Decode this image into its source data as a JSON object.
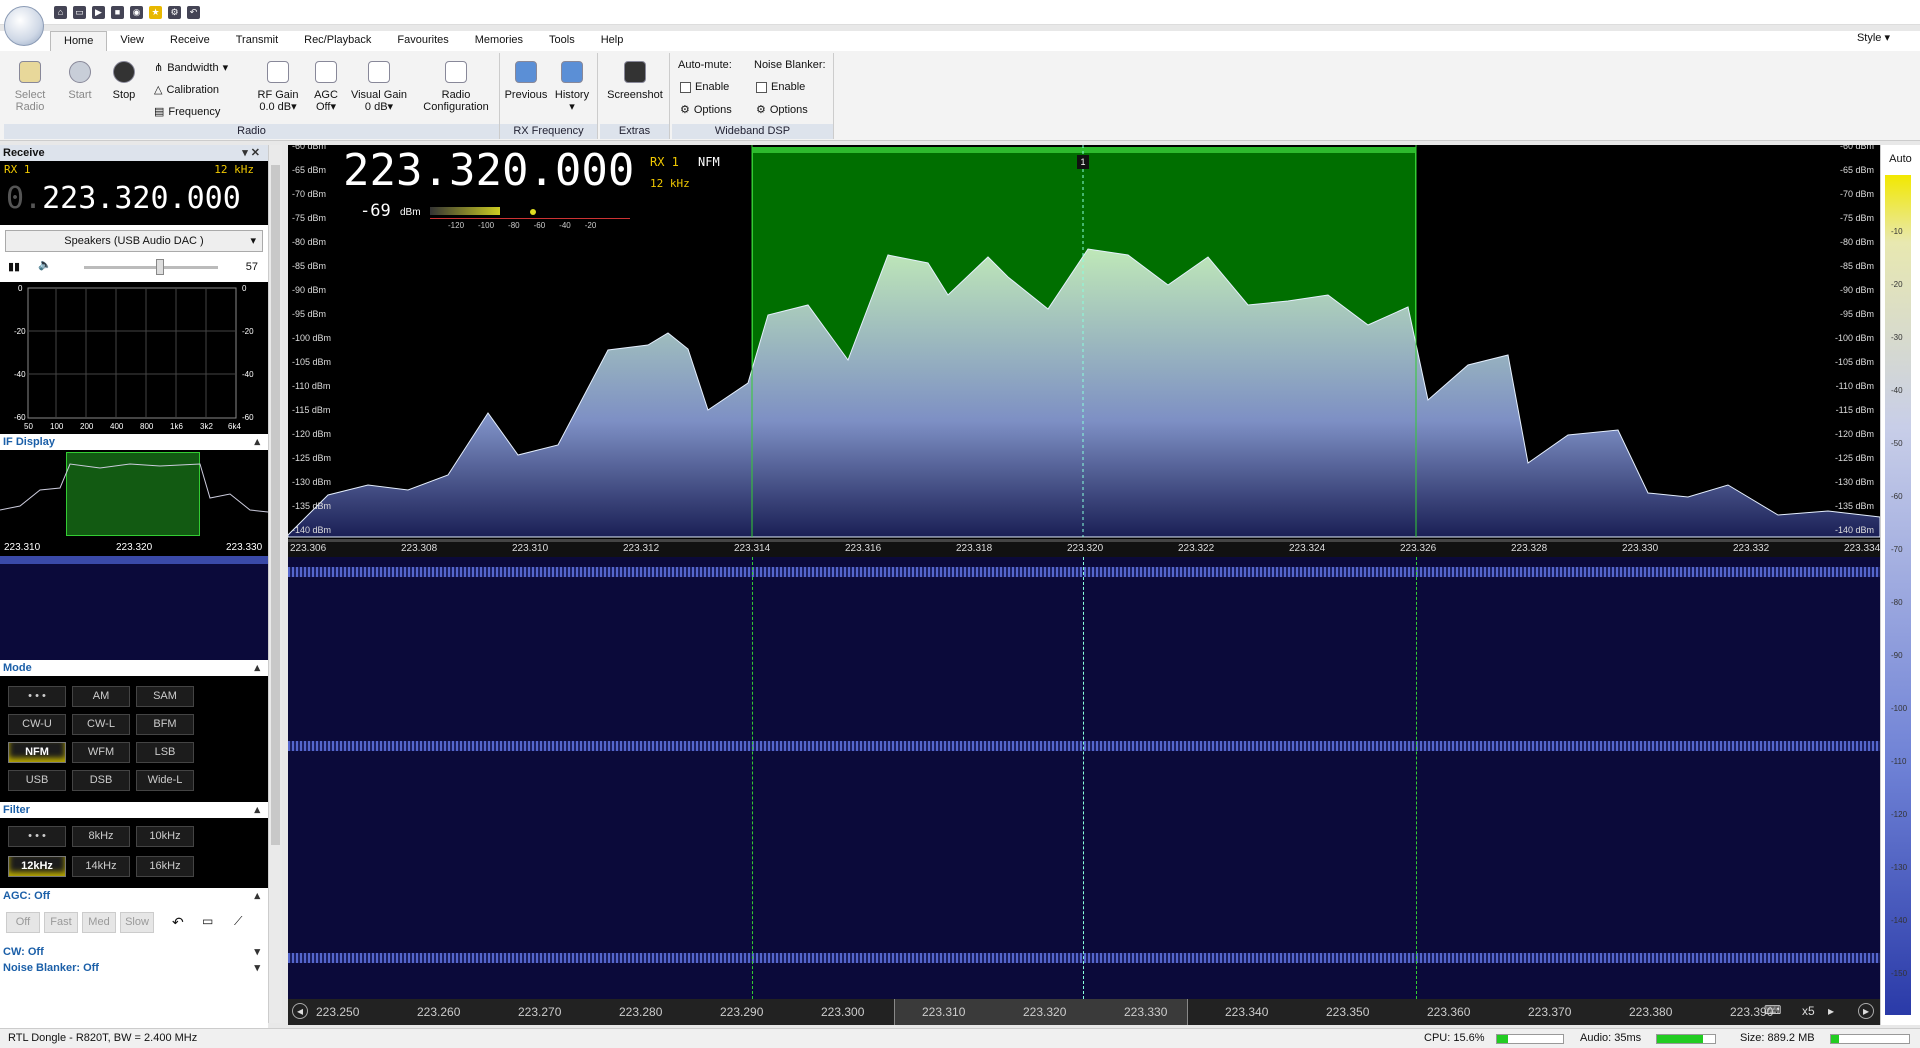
{
  "ribbon": {
    "tabs": [
      "Home",
      "View",
      "Receive",
      "Transmit",
      "Rec/Playback",
      "Favourites",
      "Memories",
      "Tools",
      "Help"
    ],
    "style_label": "Style",
    "select_radio": "Select\nRadio",
    "start": "Start",
    "stop": "Stop",
    "bandwidth": "Bandwidth",
    "calibration": "Calibration",
    "frequency": "Frequency",
    "rf_gain": "RF Gain",
    "rf_gain_val": "0.0 dB",
    "agc": "AGC",
    "agc_val": "Off",
    "visual_gain": "Visual Gain",
    "visual_gain_val": "0 dB",
    "radio_config": "Radio",
    "radio_config2": "Configuration",
    "previous": "Previous",
    "history": "History",
    "screenshot": "Screenshot",
    "auto_mute": "Auto-mute:",
    "noise_blanker": "Noise Blanker:",
    "enable": "Enable",
    "options": "Options",
    "groups": {
      "radio": "Radio",
      "rx_frequency": "RX Frequency",
      "extras": "Extras",
      "wideband_dsp": "Wideband DSP"
    }
  },
  "receive": {
    "title": "Receive",
    "rx": "RX 1",
    "bw": "12 kHz",
    "freq_lead": "0.",
    "freq": "223.320.000",
    "audio_device": "Speakers (USB Audio DAC  )",
    "volume": "57"
  },
  "audio_chart": {
    "y_labels": [
      "0",
      "-20",
      "-40",
      "-60"
    ],
    "x_labels": [
      "50",
      "100",
      "200",
      "400",
      "800",
      "1k6",
      "3k2",
      "6k4"
    ]
  },
  "if_display": {
    "title": "IF Display",
    "labels": [
      "223.310",
      "223.320",
      "223.330"
    ]
  },
  "mode": {
    "title": "Mode",
    "buttons": [
      "• • •",
      "AM",
      "SAM",
      "CW-U",
      "CW-L",
      "BFM",
      "NFM",
      "WFM",
      "LSB",
      "USB",
      "DSB",
      "Wide-L"
    ],
    "selected": "NFM"
  },
  "filter": {
    "title": "Filter",
    "buttons": [
      "• • •",
      "8kHz",
      "10kHz",
      "12kHz",
      "14kHz",
      "16kHz"
    ],
    "selected": "12kHz"
  },
  "agc": {
    "title": "AGC: Off",
    "buttons": [
      "Off",
      "Fast",
      "Med",
      "Slow"
    ]
  },
  "cw": {
    "title": "CW: Off"
  },
  "nb": {
    "title": "Noise Blanker: Off"
  },
  "spectrum": {
    "freq": "223.320.000",
    "rx": "RX 1",
    "mode": "NFM",
    "bw": "12 kHz",
    "signal": "-69",
    "signal_unit": "dBm",
    "meter_scale": [
      "-120",
      "-100",
      "-80",
      "-60",
      "-40",
      "-20"
    ],
    "marker": "1",
    "y_labels": [
      "-60 dBm",
      "-65 dBm",
      "-70 dBm",
      "-75 dBm",
      "-80 dBm",
      "-85 dBm",
      "-90 dBm",
      "-95 dBm",
      "-100 dBm",
      "-105 dBm",
      "-110 dBm",
      "-115 dBm",
      "-120 dBm",
      "-125 dBm",
      "-130 dBm",
      "-135 dBm",
      "-140 dBm"
    ],
    "x_labels": [
      "223.306",
      "223.308",
      "223.310",
      "223.312",
      "223.314",
      "223.316",
      "223.318",
      "223.320",
      "223.322",
      "223.324",
      "223.326",
      "223.328",
      "223.330",
      "223.332",
      "223.334"
    ]
  },
  "waterfall": {
    "x_labels": [
      "223.250",
      "223.260",
      "223.270",
      "223.280",
      "223.290",
      "223.300",
      "223.310",
      "223.320",
      "223.330",
      "223.340",
      "223.350",
      "223.360",
      "223.370",
      "223.380",
      "223.390"
    ],
    "zoom": "x5"
  },
  "scale_right": {
    "auto": "Auto",
    "labels": [
      "-10",
      "-20",
      "-30",
      "-40",
      "-50",
      "-60",
      "-70",
      "-80",
      "-90",
      "-100",
      "-110",
      "-120",
      "-130",
      "-140",
      "-150"
    ]
  },
  "status": {
    "device": "RTL Dongle - R820T, BW = 2.400 MHz",
    "cpu": "CPU: 15.6%",
    "audio": "Audio: 35ms",
    "size": "Size: 889.2 MB"
  }
}
